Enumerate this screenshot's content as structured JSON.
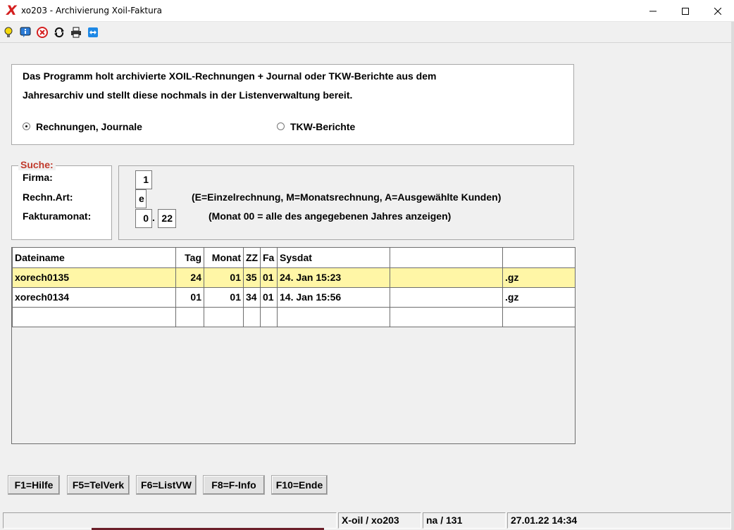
{
  "window": {
    "title": "xo203 - Archivierung Xoil-Faktura",
    "logo": "X"
  },
  "toolbar": {
    "icons": [
      "lightbulb-icon",
      "info-icon",
      "stop-icon",
      "refresh-icon",
      "print-icon",
      "teamviewer-icon"
    ]
  },
  "info": {
    "line1": "Das Programm holt archivierte XOIL-Rechnungen + Journal oder TKW-Berichte aus dem",
    "line2": "Jahresarchiv und stellt diese nochmals in der Listenverwaltung bereit.",
    "radio_invoices": "Rechnungen, Journale",
    "radio_tkw": "TKW-Berichte",
    "selected": "Rechnungen, Journale"
  },
  "search": {
    "legend": "Suche:",
    "firma_label": "Firma:",
    "art_label": "Rechn.Art:",
    "monat_label": "Fakturamonat:",
    "firma_value": "1",
    "art_value": "e",
    "monat_value": "0",
    "monat_sep": ".",
    "jahr_value": "22",
    "art_hint": "(E=Einzelrechnung, M=Monatsrechnung, A=Ausgewählte Kunden)",
    "monat_hint": "(Monat 00 = alle des angegebenen Jahres anzeigen)"
  },
  "table": {
    "headers": [
      "Dateiname",
      "Tag",
      "Monat",
      "ZZ",
      "Fa",
      "Sysdat",
      "",
      ""
    ],
    "rows": [
      [
        "xorech0135",
        "24",
        "01",
        "35",
        "01",
        "24. Jan 15:23",
        "",
        ".gz"
      ],
      [
        "xorech0134",
        "01",
        "01",
        "34",
        "01",
        "14. Jan 15:56",
        "",
        ".gz"
      ]
    ]
  },
  "buttons": {
    "f1": "F1=Hilfe",
    "f5": "F5=TelVerk",
    "f6": "F6=ListVW",
    "f8": "F8=F-Info",
    "f10": "F10=Ende"
  },
  "status": {
    "system": "X-oil / xo203",
    "user": "na / 131",
    "datetime": "27.01.22 14:34"
  },
  "colors": {
    "selected_row": "#fff6a6",
    "legend": "#c0392b",
    "logo": "#d41f1f"
  }
}
